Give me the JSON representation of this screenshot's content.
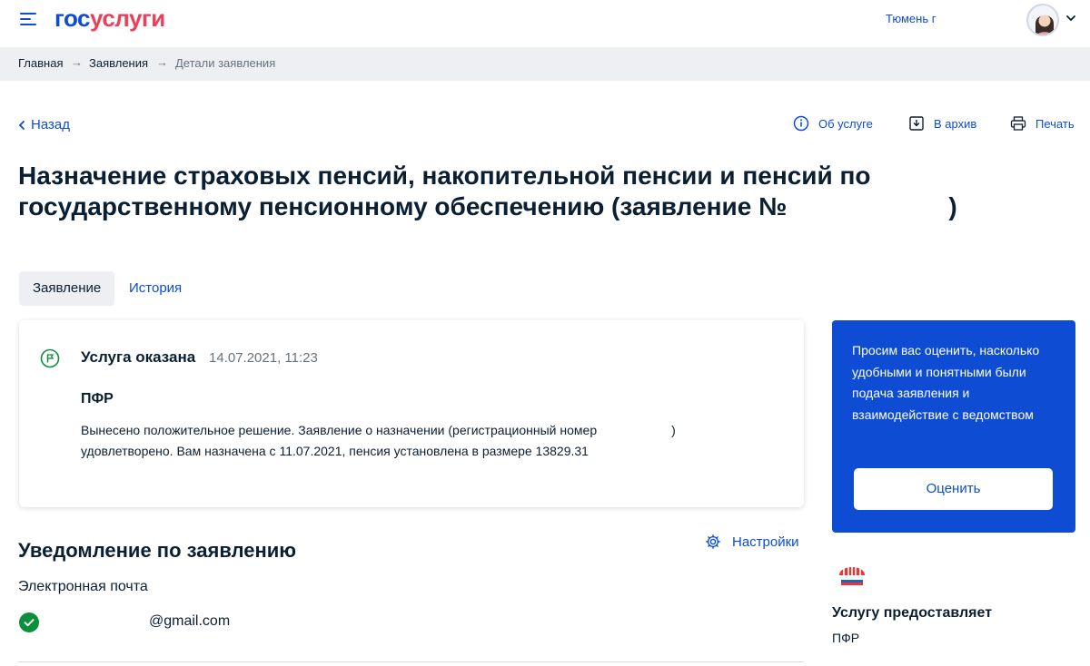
{
  "header": {
    "logo_part1": "гос",
    "logo_part2": "услуги",
    "city": "Тюмень г",
    "menu_icon": "burger-menu-icon",
    "avatar_icon": "user-avatar"
  },
  "breadcrumbs": [
    "Главная",
    "Заявления",
    "Детали заявления"
  ],
  "actions": {
    "back": "Назад",
    "about": "Об услуге",
    "archive": "В архив",
    "print": "Печать"
  },
  "page": {
    "title_line1": "Назначение страховых пенсий, накопительной пенсии и пенсий по",
    "title_line2_prefix": "государственному пенсионному обеспечению (заявление №",
    "title_line2_suffix": ")"
  },
  "tabs": [
    {
      "label": "Заявление",
      "active": true
    },
    {
      "label": "История",
      "active": false
    }
  ],
  "status_card": {
    "status": "Услуга оказана",
    "date": "14.07.2021, 11:23",
    "org": "ПФР",
    "message_line1_prefix": "Вынесено положительное решение. Заявление о назначении (регистрационный номер",
    "message_line1_suffix": ")",
    "message_line2": "удовлетворено. Вам назначена с 11.07.2021, пенсия установлена в размере 13829.31"
  },
  "notifications": {
    "title": "Уведомление по заявлению",
    "settings": "Настройки",
    "email_label": "Электронная почта",
    "email_value": "@gmail.com"
  },
  "rate_box": {
    "text": "Просим вас оценить, насколько удобными и понятными были подача заявления и взаимодействие с ведомством",
    "button": "Оценить"
  },
  "provider": {
    "title": "Услугу предоставляет",
    "name": "ПФР"
  },
  "colors": {
    "brand_blue": "#0d4cd3",
    "brand_red": "#ee3f58",
    "success_green": "#0b8f3c",
    "text_dark": "#0b1f33",
    "muted": "#66727f"
  }
}
